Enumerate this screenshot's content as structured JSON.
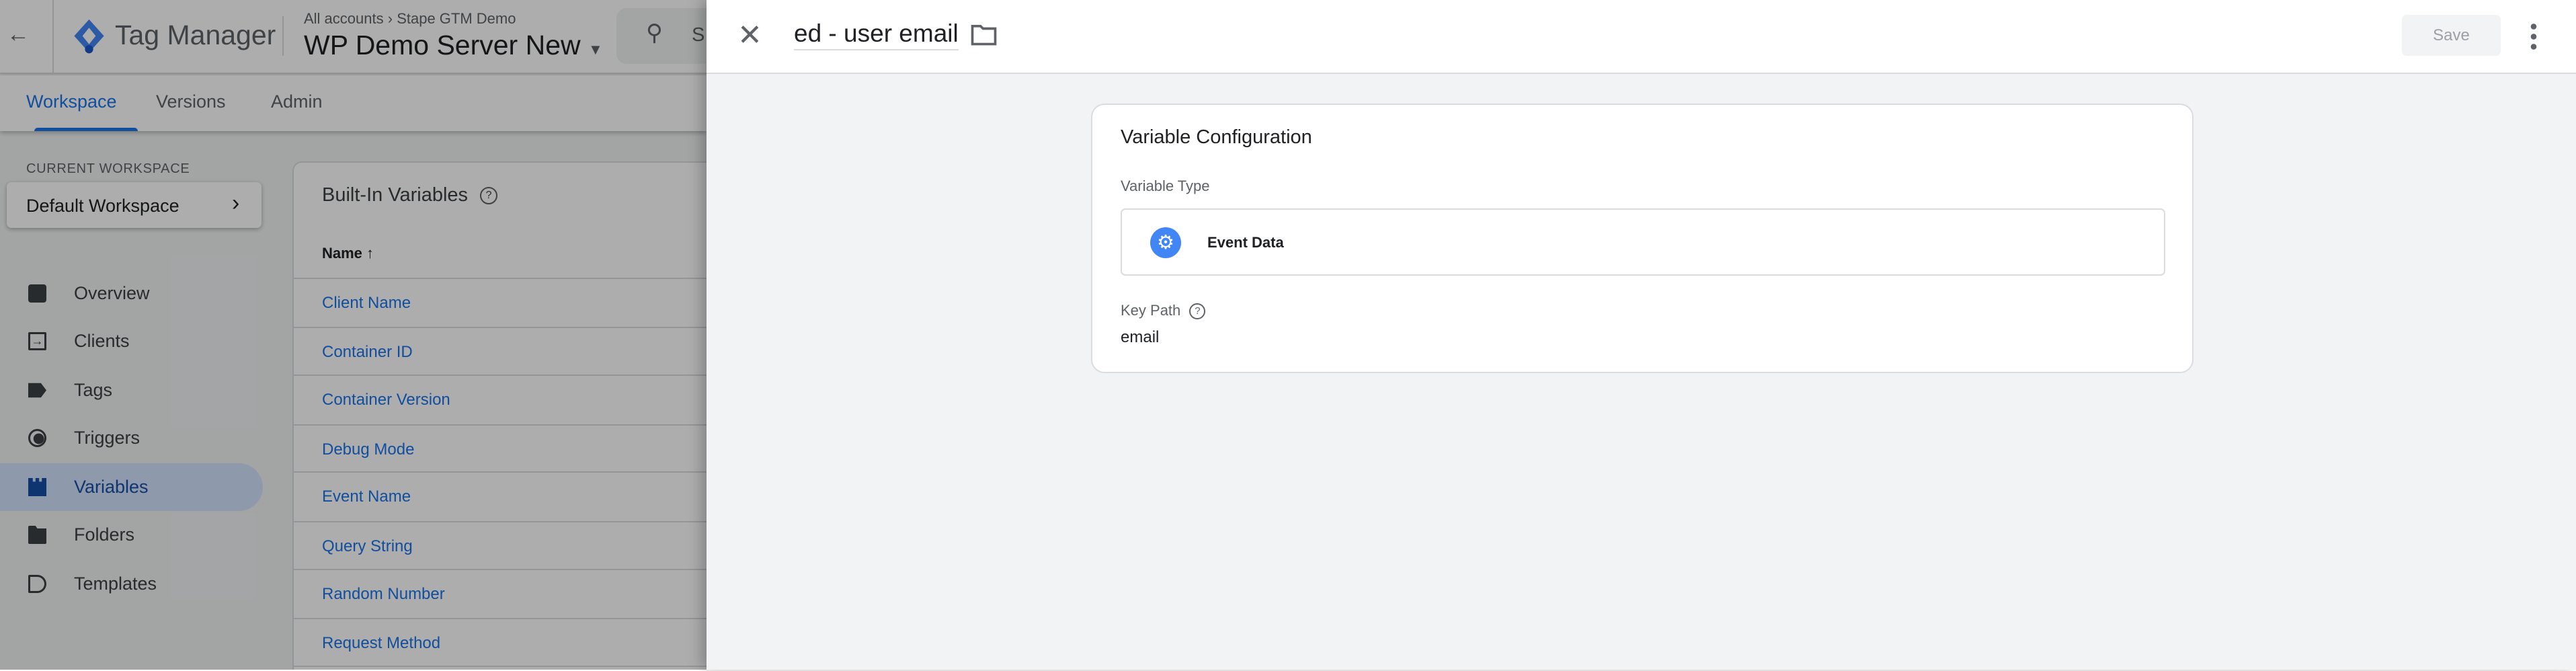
{
  "header": {
    "app_name": "Tag Manager",
    "breadcrumb": {
      "accounts": "All accounts",
      "separator": "›",
      "account": "Stape GTM Demo"
    },
    "container_name": "WP Demo Server New",
    "search_placeholder": "S"
  },
  "tabs": [
    {
      "label": "Workspace",
      "active": true
    },
    {
      "label": "Versions",
      "active": false
    },
    {
      "label": "Admin",
      "active": false
    }
  ],
  "sidebar": {
    "current_workspace_label": "CURRENT WORKSPACE",
    "workspace_name": "Default Workspace",
    "items": [
      {
        "label": "Overview",
        "icon": "overview-icon"
      },
      {
        "label": "Clients",
        "icon": "clients-icon"
      },
      {
        "label": "Tags",
        "icon": "tag-icon"
      },
      {
        "label": "Triggers",
        "icon": "trigger-icon"
      },
      {
        "label": "Variables",
        "icon": "variables-icon",
        "active": true
      },
      {
        "label": "Folders",
        "icon": "folder-icon"
      },
      {
        "label": "Templates",
        "icon": "template-icon"
      }
    ]
  },
  "builtin": {
    "title": "Built-In Variables",
    "column_name": "Name",
    "rows": [
      "Client Name",
      "Container ID",
      "Container Version",
      "Debug Mode",
      "Event Name",
      "Query String",
      "Random Number",
      "Request Method"
    ]
  },
  "panel": {
    "title": "ed - user email",
    "save_label": "Save",
    "config_title": "Variable Configuration",
    "variable_type_label": "Variable Type",
    "variable_type": "Event Data",
    "key_path_label": "Key Path",
    "key_path_value": "email"
  },
  "colors": {
    "accent": "#1a73e8",
    "type_icon": "#4285f4",
    "active_nav_bg": "#d2e3fc"
  }
}
